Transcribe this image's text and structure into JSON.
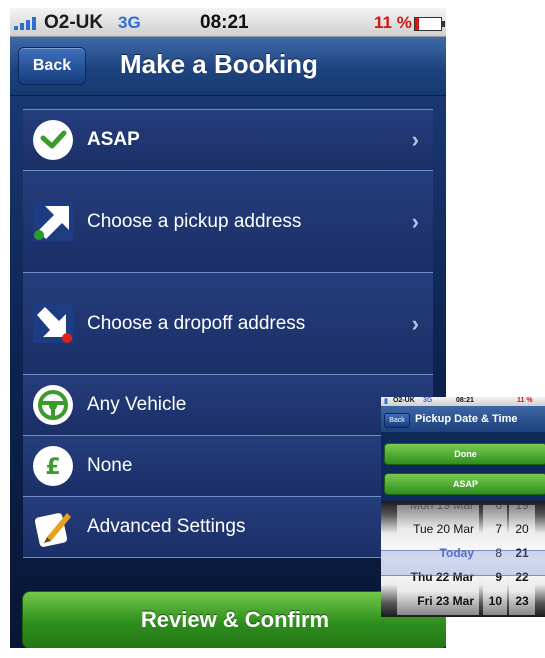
{
  "status_bar": {
    "carrier": "O2-UK",
    "network": "3G",
    "time": "08:21",
    "battery": "11 %"
  },
  "nav": {
    "back_label": "Back",
    "title": "Make a Booking"
  },
  "list": [
    {
      "label": "ASAP",
      "icon": "clock-icon"
    },
    {
      "label": "Choose a pickup address",
      "icon": "pickup-arrow-icon"
    },
    {
      "label": "Choose a dropoff address",
      "icon": "dropoff-arrow-icon"
    },
    {
      "label": "Any Vehicle",
      "icon": "steering-wheel-icon"
    },
    {
      "label": "None",
      "icon": "pound-icon"
    },
    {
      "label": "Advanced Settings",
      "icon": "pencil-icon"
    }
  ],
  "review_button": "Review & Confirm",
  "inset": {
    "status": {
      "carrier": "O2-UK",
      "network": "3G",
      "time": "08:21",
      "battery": "11 %"
    },
    "back_label": "Back",
    "title": "Pickup Date & Time",
    "done_label": "Done",
    "asap_label": "ASAP",
    "picker": {
      "dates": [
        "Mon 19 Mar",
        "Tue 20 Mar",
        "Today",
        "Thu 22 Mar",
        "Fri 23 Mar"
      ],
      "hours": [
        "6",
        "7",
        "8",
        "9",
        "10"
      ],
      "minutes": [
        "19",
        "20",
        "21",
        "22",
        "23"
      ],
      "selected_index": 2
    }
  },
  "colors": {
    "accent_green": "#2e8f1d",
    "nav_blue": "#1d437f",
    "battery_red": "#d01616",
    "selected_blue": "#4a63c9"
  }
}
